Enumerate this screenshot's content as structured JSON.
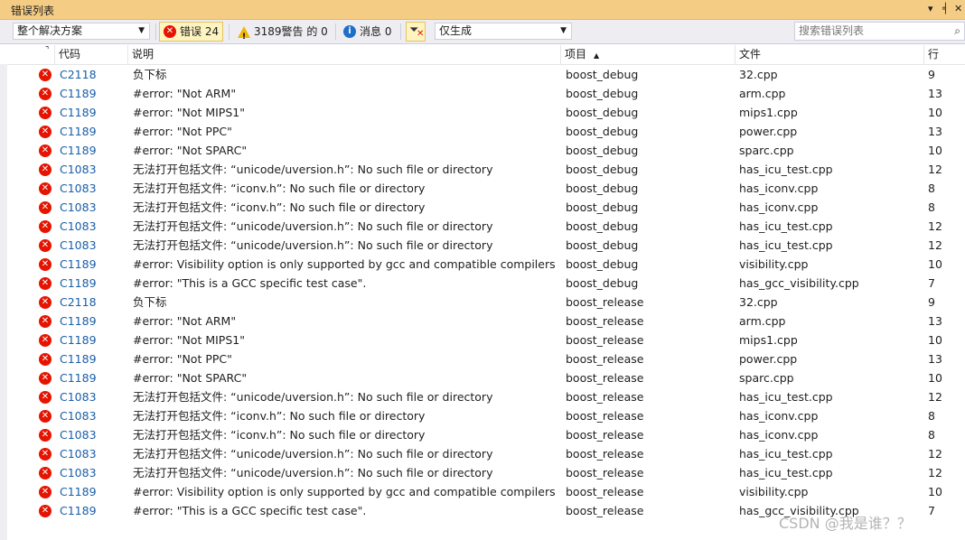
{
  "window": {
    "title": "错误列表",
    "ctl_dropdown": "▾",
    "ctl_pin": "╡",
    "ctl_close": "✕"
  },
  "toolbar": {
    "scope": "整个解决方案",
    "errors_label": "错误 24",
    "warnings_label": "3189警告 的 0",
    "messages_label": "消息 0",
    "build_filter": "仅生成",
    "search_placeholder": "搜索错误列表"
  },
  "columns": {
    "code": "代码",
    "description": "说明",
    "project": "项目",
    "file": "文件",
    "line": "行"
  },
  "rows": [
    {
      "code": "C2118",
      "desc": "负下标",
      "project": "boost_debug",
      "file": "32.cpp",
      "line": "9"
    },
    {
      "code": "C1189",
      "desc": "#error:  \"Not ARM\"",
      "project": "boost_debug",
      "file": "arm.cpp",
      "line": "13"
    },
    {
      "code": "C1189",
      "desc": "#error:  \"Not MIPS1\"",
      "project": "boost_debug",
      "file": "mips1.cpp",
      "line": "10"
    },
    {
      "code": "C1189",
      "desc": "#error:  \"Not PPC\"",
      "project": "boost_debug",
      "file": "power.cpp",
      "line": "13"
    },
    {
      "code": "C1189",
      "desc": "#error:  \"Not SPARC\"",
      "project": "boost_debug",
      "file": "sparc.cpp",
      "line": "10"
    },
    {
      "code": "C1083",
      "desc": "无法打开包括文件: “unicode/uversion.h”: No such file or directory",
      "project": "boost_debug",
      "file": "has_icu_test.cpp",
      "line": "12"
    },
    {
      "code": "C1083",
      "desc": "无法打开包括文件: “iconv.h”: No such file or directory",
      "project": "boost_debug",
      "file": "has_iconv.cpp",
      "line": "8"
    },
    {
      "code": "C1083",
      "desc": "无法打开包括文件: “iconv.h”: No such file or directory",
      "project": "boost_debug",
      "file": "has_iconv.cpp",
      "line": "8"
    },
    {
      "code": "C1083",
      "desc": "无法打开包括文件: “unicode/uversion.h”: No such file or directory",
      "project": "boost_debug",
      "file": "has_icu_test.cpp",
      "line": "12"
    },
    {
      "code": "C1083",
      "desc": "无法打开包括文件: “unicode/uversion.h”: No such file or directory",
      "project": "boost_debug",
      "file": "has_icu_test.cpp",
      "line": "12"
    },
    {
      "code": "C1189",
      "desc": "#error:  Visibility option is only supported by gcc and compatible compilers",
      "project": "boost_debug",
      "file": "visibility.cpp",
      "line": "10"
    },
    {
      "code": "C1189",
      "desc": "#error:  \"This is a GCC specific test case\".",
      "project": "boost_debug",
      "file": "has_gcc_visibility.cpp",
      "line": "7"
    },
    {
      "code": "C2118",
      "desc": "负下标",
      "project": "boost_release",
      "file": "32.cpp",
      "line": "9"
    },
    {
      "code": "C1189",
      "desc": "#error:  \"Not ARM\"",
      "project": "boost_release",
      "file": "arm.cpp",
      "line": "13"
    },
    {
      "code": "C1189",
      "desc": "#error:  \"Not MIPS1\"",
      "project": "boost_release",
      "file": "mips1.cpp",
      "line": "10"
    },
    {
      "code": "C1189",
      "desc": "#error:  \"Not PPC\"",
      "project": "boost_release",
      "file": "power.cpp",
      "line": "13"
    },
    {
      "code": "C1189",
      "desc": "#error:  \"Not SPARC\"",
      "project": "boost_release",
      "file": "sparc.cpp",
      "line": "10"
    },
    {
      "code": "C1083",
      "desc": "无法打开包括文件: “unicode/uversion.h”: No such file or directory",
      "project": "boost_release",
      "file": "has_icu_test.cpp",
      "line": "12"
    },
    {
      "code": "C1083",
      "desc": "无法打开包括文件: “iconv.h”: No such file or directory",
      "project": "boost_release",
      "file": "has_iconv.cpp",
      "line": "8"
    },
    {
      "code": "C1083",
      "desc": "无法打开包括文件: “iconv.h”: No such file or directory",
      "project": "boost_release",
      "file": "has_iconv.cpp",
      "line": "8"
    },
    {
      "code": "C1083",
      "desc": "无法打开包括文件: “unicode/uversion.h”: No such file or directory",
      "project": "boost_release",
      "file": "has_icu_test.cpp",
      "line": "12"
    },
    {
      "code": "C1083",
      "desc": "无法打开包括文件: “unicode/uversion.h”: No such file or directory",
      "project": "boost_release",
      "file": "has_icu_test.cpp",
      "line": "12"
    },
    {
      "code": "C1189",
      "desc": "#error:  Visibility option is only supported by gcc and compatible compilers",
      "project": "boost_release",
      "file": "visibility.cpp",
      "line": "10"
    },
    {
      "code": "C1189",
      "desc": "#error:  \"This is a GCC specific test case\".",
      "project": "boost_release",
      "file": "has_gcc_visibility.cpp",
      "line": "7"
    }
  ],
  "watermark": "CSDN @我是谁？？",
  "colors": {
    "title_bar": "#f5cc84",
    "error_icon": "#e51400",
    "code_link": "#1a5ea8",
    "active_filter": "#fdf4bf"
  },
  "icons": {
    "row_icon": "error-icon",
    "errors": "error-icon",
    "warnings": "warning-icon",
    "messages": "info-icon",
    "filter": "filter-clear-icon",
    "search": "search-icon",
    "sort": "sort-ascending-icon"
  }
}
